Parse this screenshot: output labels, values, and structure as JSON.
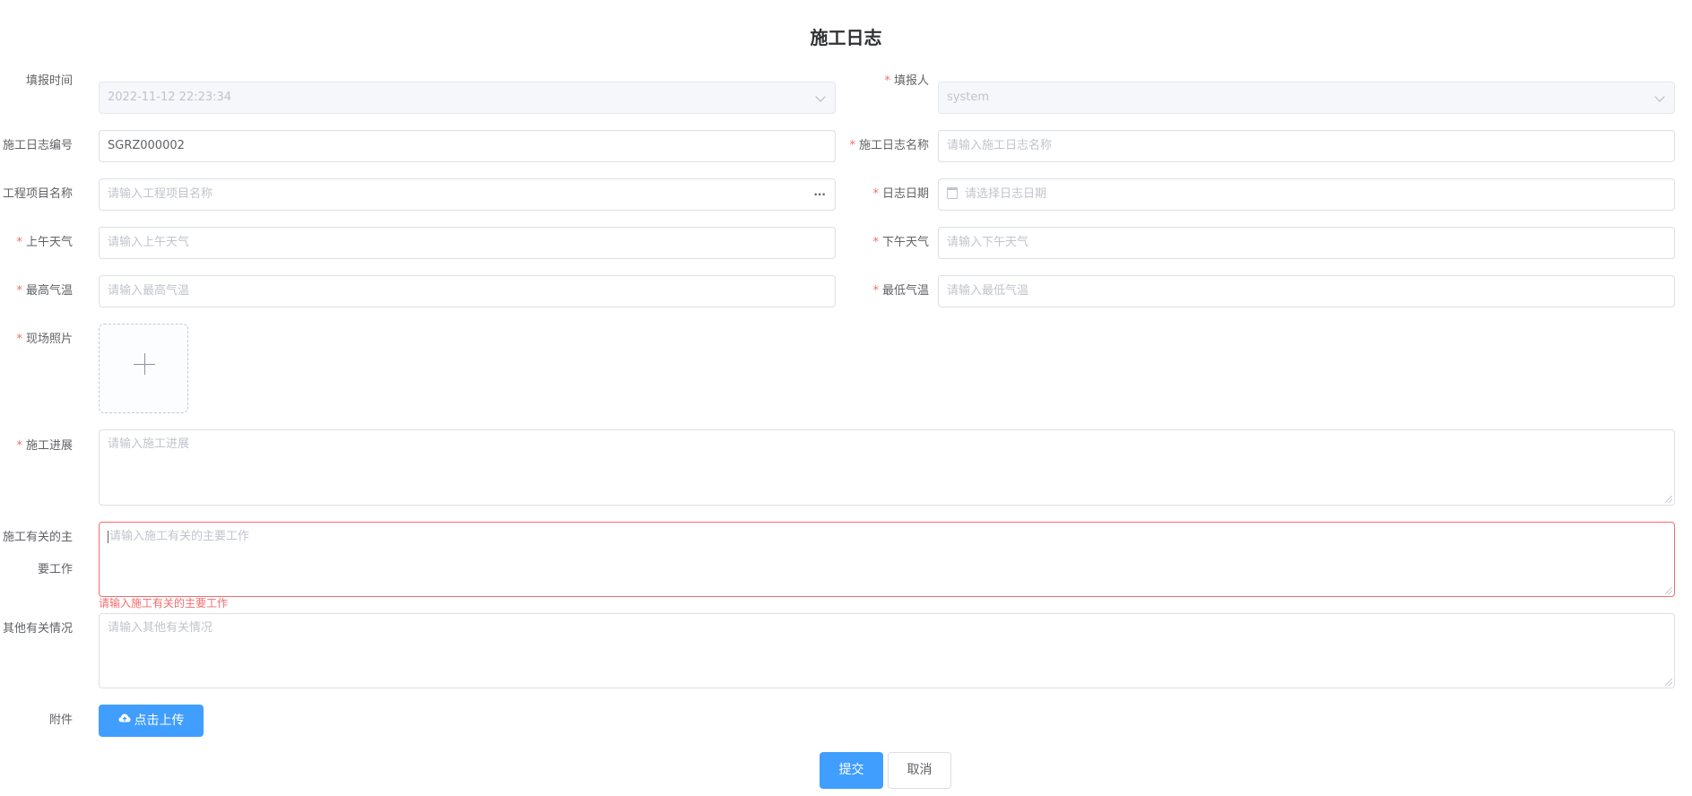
{
  "page": {
    "title": "施工日志"
  },
  "form": {
    "fill_time": {
      "label": "填报时间",
      "value": "2022-11-12 22:23:34"
    },
    "reporter": {
      "label": "填报人",
      "value": "system"
    },
    "log_number": {
      "label": "施工日志编号",
      "value": "SGRZ000002"
    },
    "log_name": {
      "label": "施工日志名称",
      "placeholder": "请输入施工日志名称"
    },
    "project_name": {
      "label": "工程项目名称",
      "placeholder": "请输入工程项目名称",
      "suffix": "···"
    },
    "log_date": {
      "label": "日志日期",
      "placeholder": "请选择日志日期"
    },
    "am_weather": {
      "label": "上午天气",
      "placeholder": "请输入上午天气"
    },
    "pm_weather": {
      "label": "下午天气",
      "placeholder": "请输入下午天气"
    },
    "max_temp": {
      "label": "最高气温",
      "placeholder": "请输入最高气温"
    },
    "min_temp": {
      "label": "最低气温",
      "placeholder": "请输入最低气温"
    },
    "site_photos": {
      "label": "现场照片"
    },
    "progress": {
      "label": "施工进展",
      "placeholder": "请输入施工进展"
    },
    "main_work": {
      "label_line1": "施工有关的主",
      "label_line2": "要工作",
      "placeholder": "请输入施工有关的主要工作",
      "error": "请输入施工有关的主要工作"
    },
    "other": {
      "label": "其他有关情况",
      "placeholder": "请输入其他有关情况"
    },
    "attachment": {
      "label": "附件",
      "upload_label": "点击上传"
    }
  },
  "actions": {
    "submit_label": "提交",
    "cancel_label": "取消"
  },
  "colors": {
    "primary": "#409eff",
    "error": "#f56c6c",
    "required": "#f56c6c"
  },
  "icons": [
    "chevron-down-icon",
    "more-icon",
    "calendar-icon",
    "plus-icon",
    "cloud-upload-icon",
    "resize-handle-icon"
  ]
}
